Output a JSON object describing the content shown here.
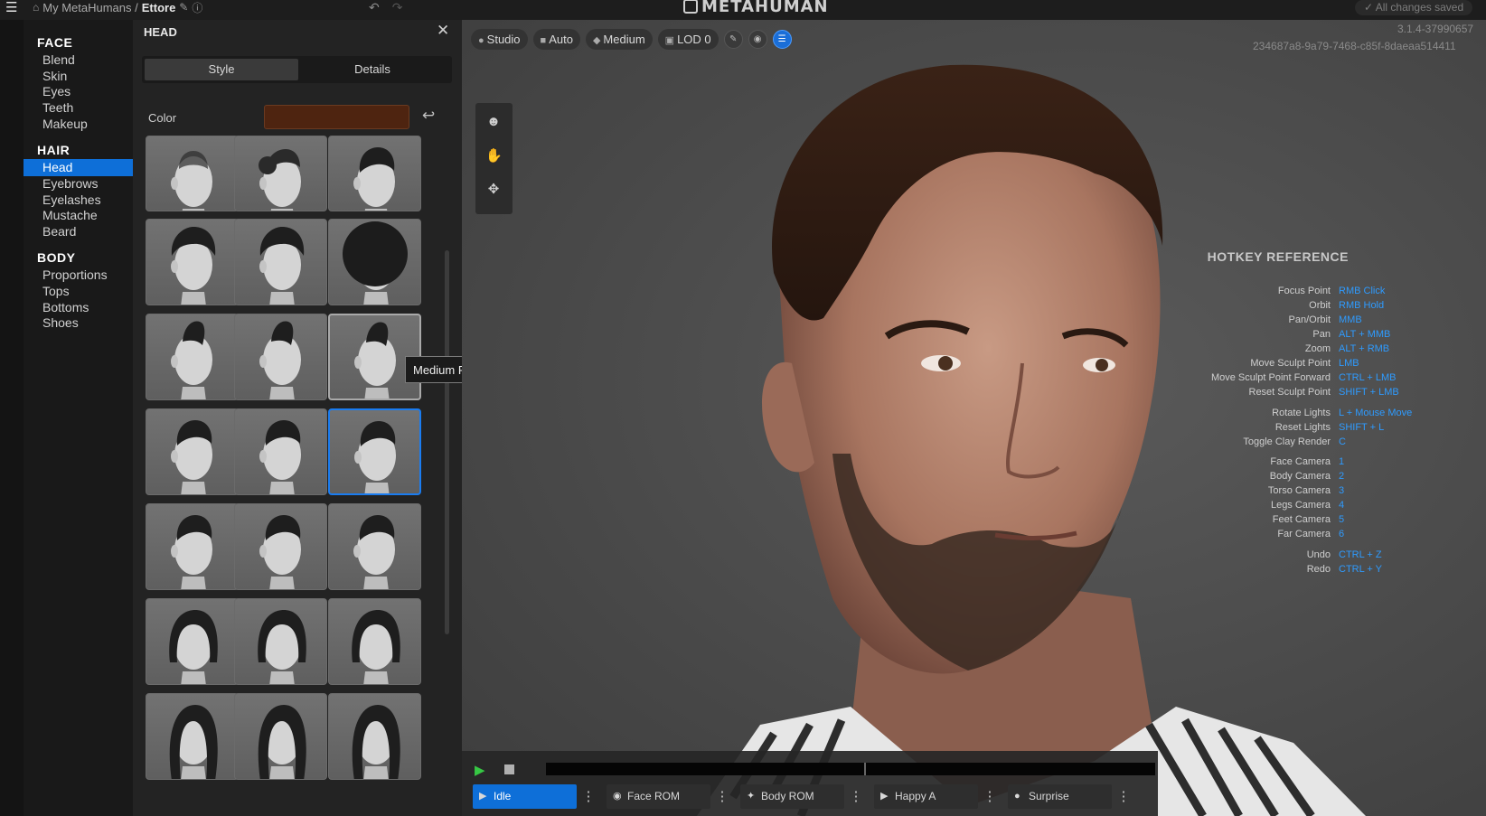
{
  "topbar": {
    "breadcrumb_root": "My MetaHumans /",
    "breadcrumb_current": "Ettore",
    "logo_text": "METAHUMAN",
    "saved_status": "All changes saved"
  },
  "categories": {
    "face_header": "FACE",
    "face_items": [
      "Blend",
      "Skin",
      "Eyes",
      "Teeth",
      "Makeup"
    ],
    "hair_header": "HAIR",
    "hair_items": [
      "Head",
      "Eyebrows",
      "Eyelashes",
      "Mustache",
      "Beard"
    ],
    "body_header": "BODY",
    "body_items": [
      "Proportions",
      "Tops",
      "Bottoms",
      "Shoes"
    ],
    "selected": "Head"
  },
  "hair_panel": {
    "title": "HEAD",
    "tabs": [
      "Style",
      "Details"
    ],
    "active_tab": "Style",
    "color_label": "Color",
    "color_value": "#4e2410",
    "tooltip": "Medium Faux Mohawk"
  },
  "viewport": {
    "toolbar": [
      "Studio",
      "Auto",
      "Medium",
      "LOD 0"
    ],
    "version": "3.1.4-37990657",
    "guid": "234687a8-9a79-7468-c85f-8daeaa514411"
  },
  "hotkeys": {
    "title": "HOTKEY REFERENCE",
    "rows": [
      {
        "k": "Focus Point",
        "v": "RMB Click"
      },
      {
        "k": "Orbit",
        "v": "RMB Hold"
      },
      {
        "k": "Pan/Orbit",
        "v": "MMB"
      },
      {
        "k": "Pan",
        "v": "ALT + MMB"
      },
      {
        "k": "Zoom",
        "v": "ALT + RMB"
      },
      {
        "k": "Move Sculpt Point",
        "v": "LMB"
      },
      {
        "k": "Move Sculpt Point Forward",
        "v": "CTRL + LMB"
      },
      {
        "k": "Reset Sculpt Point",
        "v": "SHIFT + LMB"
      },
      {
        "k": "Rotate Lights",
        "v": "L + Mouse Move"
      },
      {
        "k": "Reset Lights",
        "v": "SHIFT + L"
      },
      {
        "k": "Toggle Clay Render",
        "v": "C"
      },
      {
        "k": "Face Camera",
        "v": "1"
      },
      {
        "k": "Body Camera",
        "v": "2"
      },
      {
        "k": "Torso Camera",
        "v": "3"
      },
      {
        "k": "Legs Camera",
        "v": "4"
      },
      {
        "k": "Feet Camera",
        "v": "5"
      },
      {
        "k": "Far Camera",
        "v": "6"
      },
      {
        "k": "Undo",
        "v": "CTRL + Z"
      },
      {
        "k": "Redo",
        "v": "CTRL + Y"
      }
    ]
  },
  "animation": {
    "buttons": [
      "Idle",
      "Face ROM",
      "Body ROM",
      "Happy A",
      "Surprise"
    ],
    "selected": "Idle"
  },
  "colors": {
    "accent": "#0e6fd8",
    "hotkey_value": "#2e9bff",
    "play": "#36c744"
  }
}
